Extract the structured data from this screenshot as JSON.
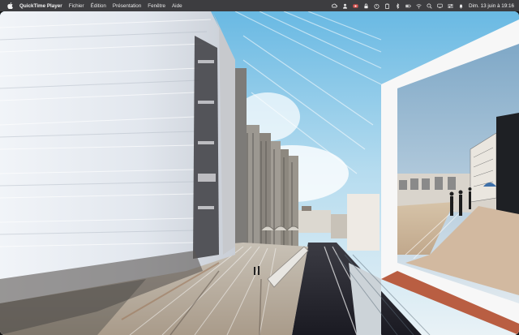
{
  "menubar": {
    "app_name": "QuickTime Player",
    "menus": [
      "Fichier",
      "Édition",
      "Présentation",
      "Fenêtre",
      "Aide"
    ],
    "status_icons": [
      "creative-cloud-icon",
      "user-icon",
      "recorder-icon",
      "lock-icon",
      "timer-icon",
      "clipboard-icon",
      "bluetooth-icon",
      "battery-icon",
      "wifi-icon",
      "spotlight-search-icon",
      "display-icon",
      "control-center-icon",
      "notification-icon"
    ],
    "clock": "Dim. 13 juin à 19:16"
  },
  "content": {
    "type": "distorted-photo",
    "scene_description_icon": "photo-frame-icon"
  }
}
